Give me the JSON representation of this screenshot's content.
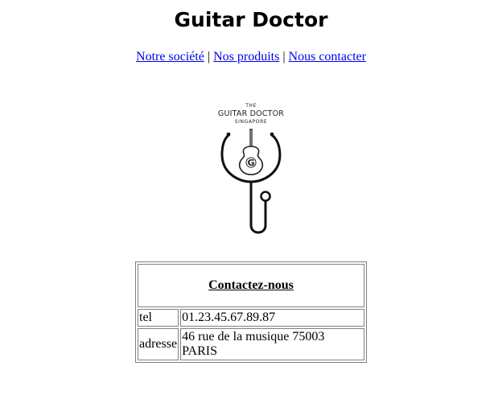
{
  "page": {
    "title": "Guitar Doctor"
  },
  "nav": {
    "items": [
      {
        "label": "Notre société"
      },
      {
        "label": "Nos produits"
      },
      {
        "label": "Nous contacter"
      }
    ],
    "separator": "|"
  },
  "logo": {
    "line1": "THE",
    "line2": "GUITAR DOCTOR",
    "line3": "SINGAPORE",
    "letter": "G"
  },
  "contact": {
    "heading": "Contactez-nous",
    "rows": [
      {
        "label": "tel",
        "value": "01.23.45.67.89.87"
      },
      {
        "label": "adresse",
        "value": "46 rue de la musique 75003 PARIS"
      }
    ]
  }
}
